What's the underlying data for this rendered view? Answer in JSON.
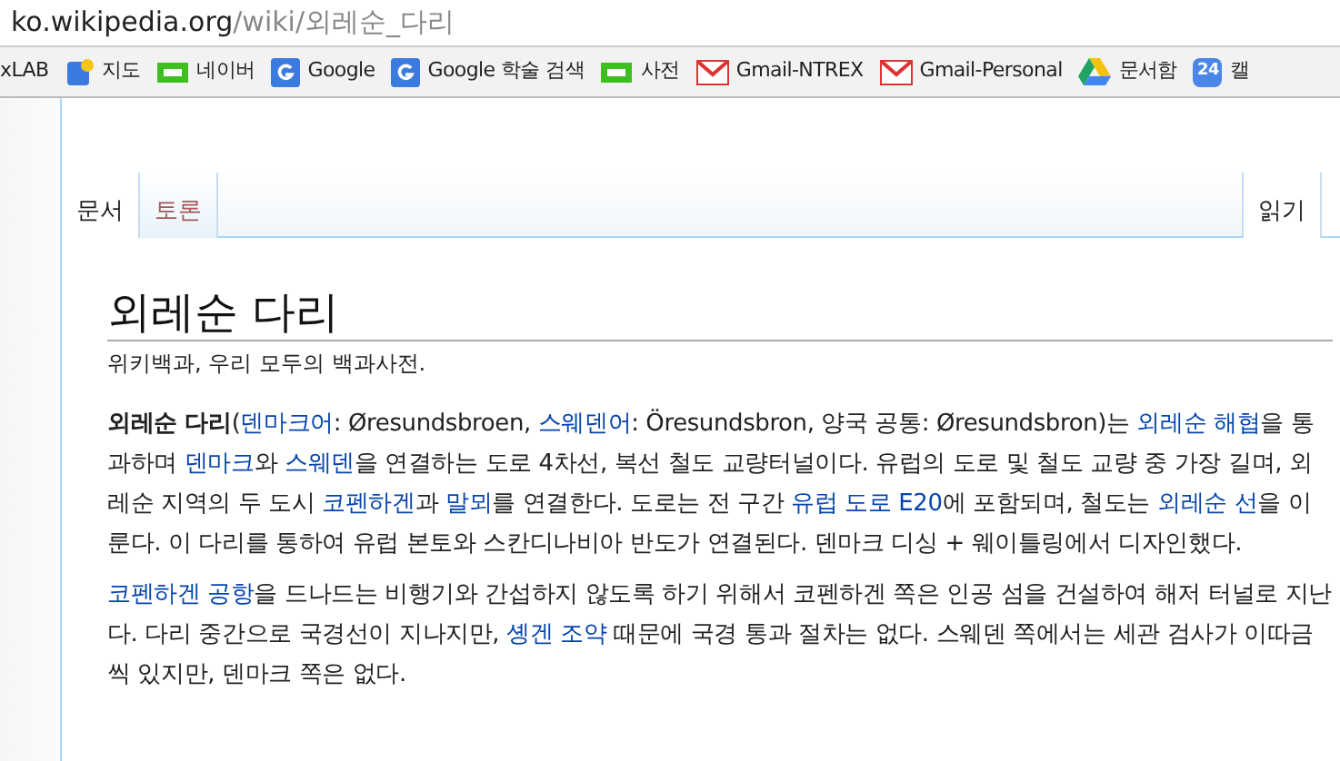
{
  "address_bar": {
    "domain": "ko.wikipedia.org",
    "path": "/wiki/외레순_다리"
  },
  "bookmarks": [
    {
      "label": "xLAB",
      "kind": "plain"
    },
    {
      "label": "지도",
      "kind": "maps"
    },
    {
      "label": "네이버",
      "kind": "naver"
    },
    {
      "label": "Google",
      "kind": "google"
    },
    {
      "label": "Google 학술 검색",
      "kind": "google"
    },
    {
      "label": "사전",
      "kind": "naver"
    },
    {
      "label": "Gmail-NTREX",
      "kind": "gmail"
    },
    {
      "label": "Gmail-Personal",
      "kind": "gmail"
    },
    {
      "label": "문서함",
      "kind": "drive"
    },
    {
      "label": "캘",
      "kind": "calendar",
      "icon_text": "24"
    }
  ],
  "left_tabs": [
    {
      "label": "문서",
      "selected": true,
      "exists": true
    },
    {
      "label": "토론",
      "selected": false,
      "exists": false
    }
  ],
  "right_tabs": [
    {
      "label": "읽기",
      "selected": true,
      "exists": true
    }
  ],
  "heading": "외레순 다리",
  "tagline": "위키백과, 우리 모두의 백과사전.",
  "paragraphs": [
    [
      {
        "kind": "bold",
        "text": "외레순 다리"
      },
      {
        "kind": "text",
        "text": "("
      },
      {
        "kind": "link",
        "text": "덴마크어"
      },
      {
        "kind": "text",
        "text": ": Øresundsbroen, "
      },
      {
        "kind": "link",
        "text": "스웨덴어"
      },
      {
        "kind": "text",
        "text": ": Öresundsbron, 양국 공통: Øresundsbron)는 "
      },
      {
        "kind": "link",
        "text": "외레순 해협"
      },
      {
        "kind": "text",
        "text": "을 통과하며 "
      },
      {
        "kind": "link",
        "text": "덴마크"
      },
      {
        "kind": "text",
        "text": "와 "
      },
      {
        "kind": "link",
        "text": "스웨덴"
      },
      {
        "kind": "text",
        "text": "을 연결하는 도로 4차선, 복선 철도 교량터널이다. 유럽의 도로 및 철도 교량 중 가장 길며, 외레순 지역의 두 도시 "
      },
      {
        "kind": "link",
        "text": "코펜하겐"
      },
      {
        "kind": "text",
        "text": "과 "
      },
      {
        "kind": "link",
        "text": "말뫼"
      },
      {
        "kind": "text",
        "text": "를 연결한다. 도로는 전 구간 "
      },
      {
        "kind": "link",
        "text": "유럽 도로 E20"
      },
      {
        "kind": "text",
        "text": "에 포함되며, 철도는 "
      },
      {
        "kind": "link",
        "text": "외레순 선"
      },
      {
        "kind": "text",
        "text": "을 이룬다. 이 다리를 통하여 유럽 본토와 스칸디나비아 반도가 연결된다. 덴마크 디싱 + 웨이틀링에서 디자인했다."
      }
    ],
    [
      {
        "kind": "link",
        "text": "코펜하겐 공항"
      },
      {
        "kind": "text",
        "text": "을 드나드는 비행기와 간섭하지 않도록 하기 위해서 코펜하겐 쪽은 인공 섬을 건설하여 해저 터널로 지난다. 다리 중간으로 국경선이 지나지만, "
      },
      {
        "kind": "link",
        "text": "솅겐 조약"
      },
      {
        "kind": "text",
        "text": " 때문에 국경 통과 절차는 없다. 스웨덴 쪽에서는 세관 검사가 이따금씩 있지만, 덴마크 쪽은 없다."
      }
    ]
  ]
}
